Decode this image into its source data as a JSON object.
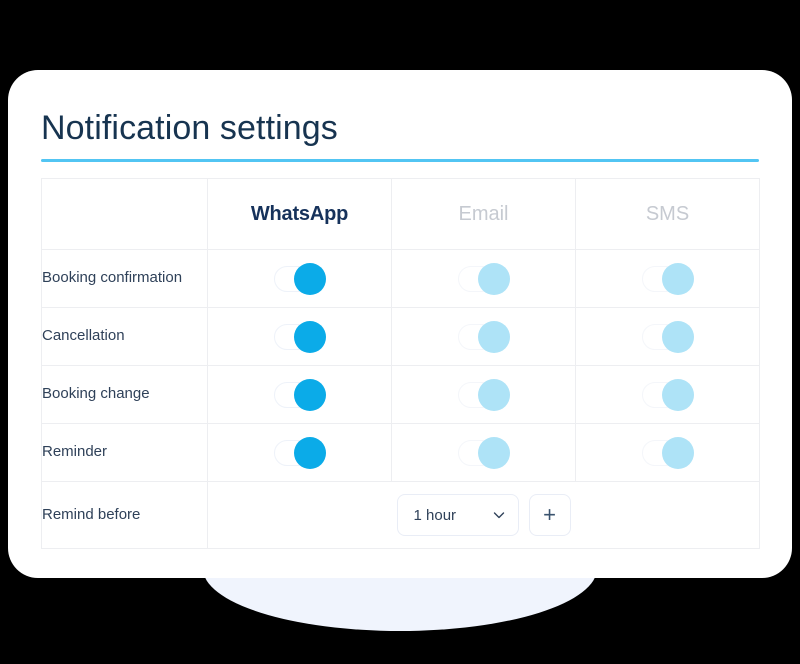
{
  "page": {
    "title": "Notification settings",
    "accent_underline_color": "#52C5F3",
    "title_color": "#173450",
    "card_background": "#FFFFFF",
    "page_background": "#000000",
    "glow_color": "#F0F4FD"
  },
  "table": {
    "columns": [
      {
        "label": "",
        "state": "empty"
      },
      {
        "label": "WhatsApp",
        "state": "active",
        "color": "#16325B"
      },
      {
        "label": "Email",
        "state": "muted",
        "color": "#C6CAD1"
      },
      {
        "label": "SMS",
        "state": "muted",
        "color": "#C6CAD1"
      }
    ],
    "rows": [
      {
        "label": "Booking confirmation",
        "toggles": [
          {
            "channel": "WhatsApp",
            "on": true,
            "knob_color": "#0BABE8"
          },
          {
            "channel": "Email",
            "on": false,
            "knob_color": "#AEE3F7"
          },
          {
            "channel": "SMS",
            "on": false,
            "knob_color": "#AEE3F7"
          }
        ]
      },
      {
        "label": "Cancellation",
        "toggles": [
          {
            "channel": "WhatsApp",
            "on": true,
            "knob_color": "#0BABE8"
          },
          {
            "channel": "Email",
            "on": false,
            "knob_color": "#AEE3F7"
          },
          {
            "channel": "SMS",
            "on": false,
            "knob_color": "#AEE3F7"
          }
        ]
      },
      {
        "label": "Booking change",
        "toggles": [
          {
            "channel": "WhatsApp",
            "on": true,
            "knob_color": "#0BABE8"
          },
          {
            "channel": "Email",
            "on": false,
            "knob_color": "#AEE3F7"
          },
          {
            "channel": "SMS",
            "on": false,
            "knob_color": "#AEE3F7"
          }
        ]
      },
      {
        "label": "Reminder",
        "toggles": [
          {
            "channel": "WhatsApp",
            "on": true,
            "knob_color": "#0BABE8"
          },
          {
            "channel": "Email",
            "on": false,
            "knob_color": "#AEE3F7"
          },
          {
            "channel": "SMS",
            "on": false,
            "knob_color": "#AEE3F7"
          }
        ]
      }
    ],
    "remind_before_row": {
      "label": "Remind before",
      "select": {
        "value": "1 hour",
        "icon": "chevron-down-icon"
      },
      "add_button": {
        "label": "+",
        "icon": "plus-icon"
      }
    }
  }
}
